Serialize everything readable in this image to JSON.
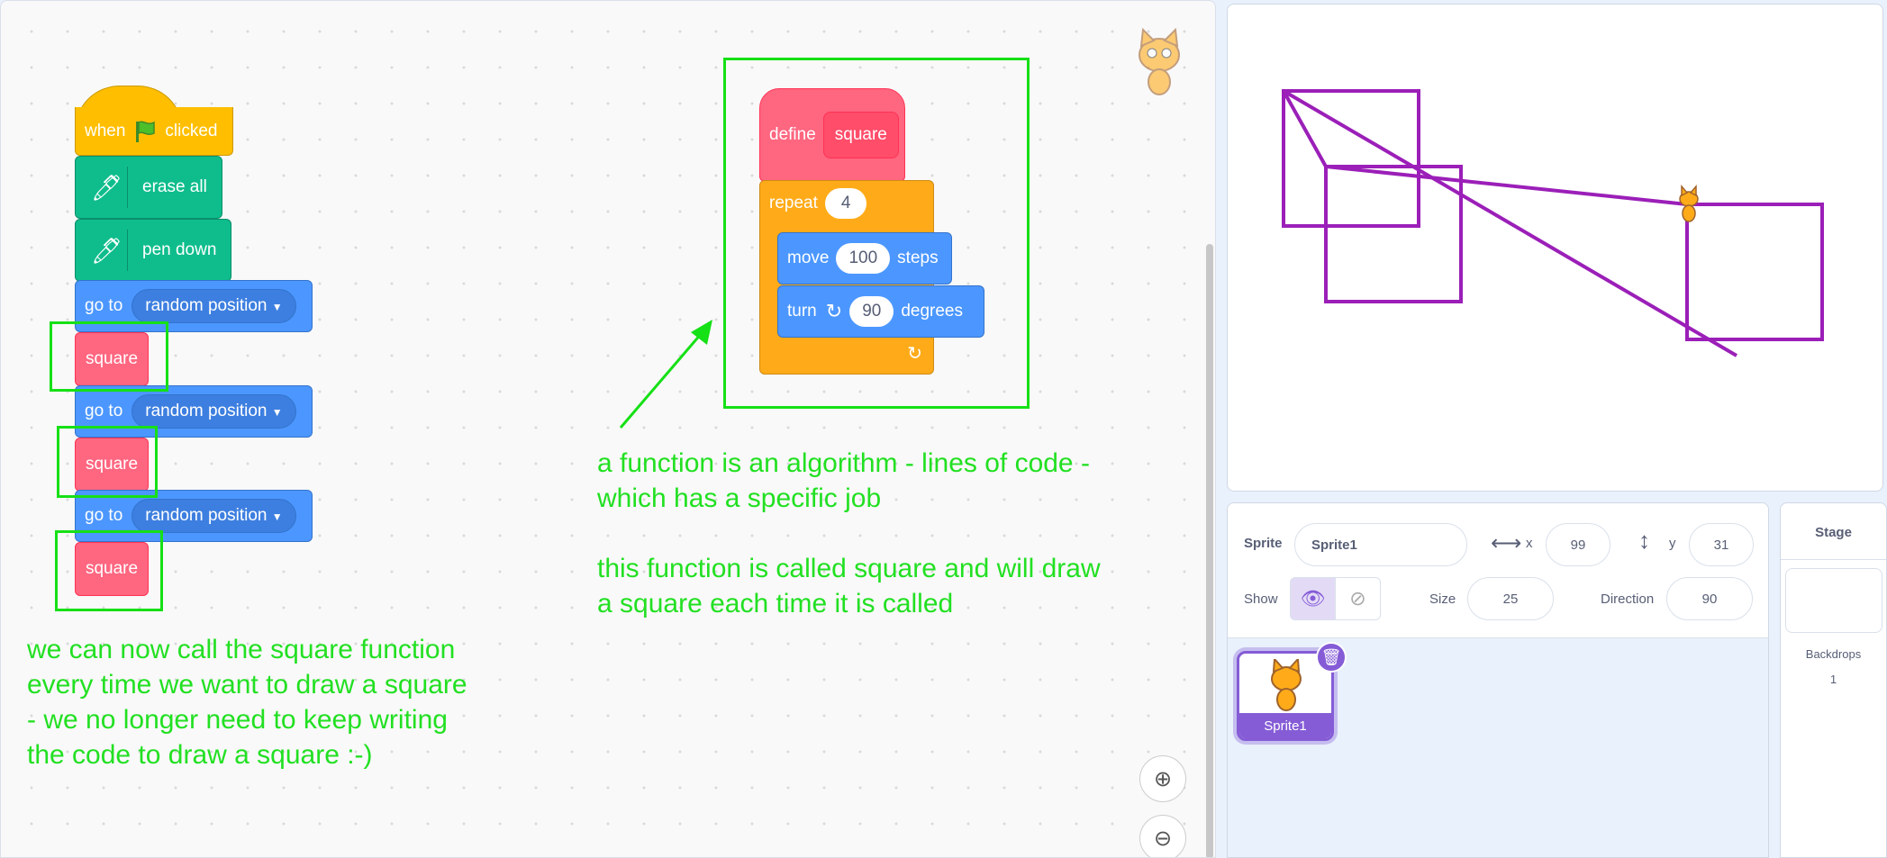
{
  "blocks": {
    "when_flag": {
      "when": "when",
      "clicked": "clicked",
      "flag_icon": "green-flag-icon"
    },
    "erase_all": "erase all",
    "pen_down": "pen down",
    "go_to": "go to",
    "random_position": "random position",
    "square": "square",
    "define": "define",
    "repeat": "repeat",
    "repeat_count": "4",
    "move": "move",
    "move_steps": "100",
    "steps": "steps",
    "turn": "turn",
    "turn_degrees": "90",
    "degrees": "degrees"
  },
  "notes": {
    "function_note": "a function is an algorithm - lines of code -\nwhich has a specific job\n\nthis function is called square and will draw\na square each time it is called",
    "call_note": "we can now call the square function\nevery time we want to draw a square\n- we no longer need to keep writing\nthe code to draw a square :-)"
  },
  "colors": {
    "events": "#ffbf00",
    "pen": "#0fbd8c",
    "motion": "#4c97ff",
    "custom": "#ff6680",
    "control": "#ffab19",
    "annotation": "#16e016",
    "pen_trail": "#9b1fb8"
  },
  "sprite_info": {
    "sprite_label": "Sprite",
    "sprite_name": "Sprite1",
    "x_label": "x",
    "x_value": "99",
    "y_label": "y",
    "y_value": "31",
    "show_label": "Show",
    "size_label": "Size",
    "size_value": "25",
    "direction_label": "Direction",
    "direction_value": "90"
  },
  "sprites": [
    {
      "name": "Sprite1",
      "selected": true
    }
  ],
  "stage_panel": {
    "title": "Stage",
    "backdrops_label": "Backdrops",
    "backdrops_count": "1"
  }
}
